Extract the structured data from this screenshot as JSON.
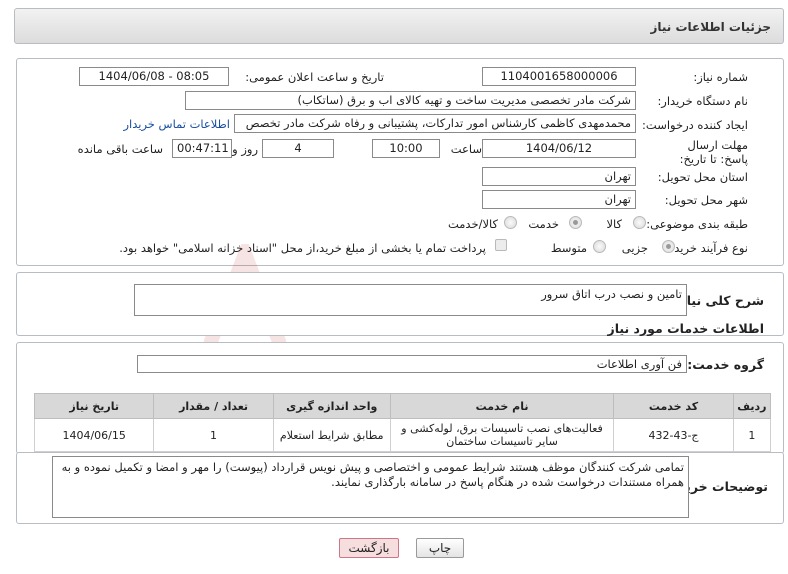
{
  "header": {
    "title": "جزئیات اطلاعات نیاز"
  },
  "form": {
    "need_number_label": "شماره نیاز:",
    "need_number": "1104001658000006",
    "announce_datetime_label": "تاریخ و ساعت اعلان عمومی:",
    "announce_datetime": "1404/06/08 - 08:05",
    "buyer_org_label": "نام دستگاه خریدار:",
    "buyer_org": "شرکت مادر تخصصی مدیریت ساخت و تهیه کالای اب و برق (ساتکاب)",
    "requester_label": "ایجاد کننده درخواست:",
    "requester": "محمدمهدی کاظمی کارشناس امور تدارکات، پشتیبانی و رفاه شرکت مادر تخصص",
    "buyer_contact_link": "اطلاعات تماس خریدار",
    "deadline_label": "مهلت ارسال پاسخ: تا تاریخ:",
    "deadline_date": "1404/06/12",
    "time_label": "ساعت",
    "deadline_time": "10:00",
    "days_count": "4",
    "days_label": "روز و",
    "remaining_time": "00:47:11",
    "remaining_label": "ساعت باقی مانده",
    "province_label": "استان محل تحویل:",
    "province": "تهران",
    "city_label": "شهر محل تحویل:",
    "city": "تهران",
    "category_label": "طبقه بندی موضوعی:",
    "category_options": [
      "کالا",
      "خدمت",
      "کالا/خدمت"
    ],
    "category_selected": "خدمت",
    "process_label": "نوع فرآیند خرید :",
    "process_options": [
      "جزیی",
      "متوسط"
    ],
    "process_selected": "جزیی",
    "payment_note": "پرداخت تمام یا بخشی از مبلغ خرید،از محل \"اسناد خزانه اسلامی\" خواهد بود."
  },
  "summary": {
    "label": "شرح کلی نیاز:",
    "value": "تامین و نصب درب اتاق سرور"
  },
  "services": {
    "section_title": "اطلاعات خدمات مورد نیاز",
    "group_label": "گروه خدمت:",
    "group_value": "فن آوری اطلاعات",
    "columns": [
      "ردیف",
      "کد خدمت",
      "نام خدمت",
      "واحد اندازه گیری",
      "تعداد / مقدار",
      "تاریخ نیاز"
    ],
    "rows": [
      {
        "row": "1",
        "code": "ج-43-432",
        "name": "فعالیت‌های نصب تاسیسات برق، لوله‌کشی و سایر تاسیسات ساختمان",
        "unit": "مطابق شرایط استعلام",
        "qty": "1",
        "date": "1404/06/15"
      }
    ]
  },
  "buyer_notes": {
    "label": "توضیحات خریدار:",
    "value": "تمامی شرکت کنندگان موظف هستند شرایط عمومی و اختصاصی و پیش نویس قرارداد (پیوست) را مهر و امضا و تکمیل نموده و به همراه مستندات درخواست شده در هنگام پاسخ در سامانه بارگذاری نمایند."
  },
  "buttons": {
    "print": "چاپ",
    "back": "بازگشت"
  },
  "watermark": {
    "text": "AriaTender.net"
  },
  "colors": {
    "link": "#1a4fa0",
    "back_button_bg": "#f6dede",
    "table_header_bg": "#d8d8d8"
  }
}
